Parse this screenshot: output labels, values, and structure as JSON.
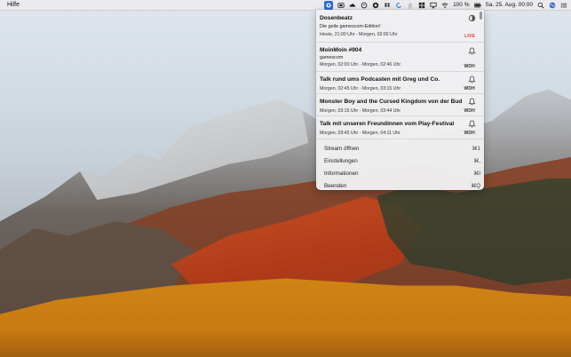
{
  "menubar": {
    "left_menu": "Hilfe",
    "battery_percent": "100 %",
    "datetime": "Sa. 25. Aug.  00:00"
  },
  "status_icons": [
    "radio-icon",
    "app-icon",
    "cloud-icon",
    "circle-icon",
    "record-icon",
    "dropbox-icon",
    "cloudsync-icon",
    "hand-icon",
    "grid-icon",
    "airplay-icon",
    "wifi-icon",
    "battery-icon",
    "search-icon",
    "siri-icon",
    "list-icon"
  ],
  "shows": [
    {
      "title": "Dosenbeatz",
      "description": "Die geile gamescom-Edition!",
      "time": "Heute, 21:00 Uhr - Morgen, 02:00 Uhr",
      "tag": "LIVE",
      "icon": "half-moon-icon"
    },
    {
      "title": "MoinMoin #904",
      "description": "gamescom",
      "time": "Morgen, 02:00 Uhr - Morgen, 02:46 Uhr",
      "tag": "WDH",
      "icon": "bell-icon"
    },
    {
      "title": "Talk rund ums Podcasten mit Greg und Co.",
      "description": "",
      "time": "Morgen, 02:45 Uhr - Morgen, 03:15 Uhr",
      "tag": "WDH",
      "icon": "bell-icon"
    },
    {
      "title": "Monster Boy and the Cursed Kingdom von der Bud",
      "description": "",
      "time": "Morgen, 03:15 Uhr - Morgen, 03:44 Uhr",
      "tag": "WDH",
      "icon": "bell-icon"
    },
    {
      "title": "Talk mit unseren Freundinnen vom Play-Festival",
      "description": "",
      "time": "Morgen, 03:45 Uhr - Morgen, 04:11 Uhr",
      "tag": "WDH",
      "icon": "bell-icon"
    }
  ],
  "menu": [
    {
      "label": "Stream öffnen",
      "shortcut": "⌘1"
    },
    {
      "label": "Einstellungen",
      "shortcut": "⌘,"
    },
    {
      "label": "Informationen",
      "shortcut": "⌘I"
    },
    {
      "label": "Beenden",
      "shortcut": "⌘Q"
    }
  ],
  "colors": {
    "live": "#e03c31",
    "panel": "#efeff1",
    "active_icon": "#2f6bd9"
  }
}
